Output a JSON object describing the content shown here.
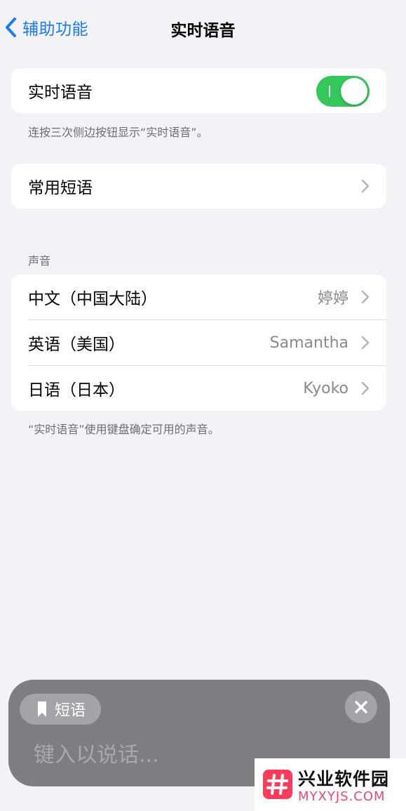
{
  "nav": {
    "back_label": "辅助功能",
    "title": "实时语音"
  },
  "main_toggle": {
    "label": "实时语音",
    "on": true,
    "footnote": "连按三次侧边按钮显示“实时语音”。"
  },
  "phrases": {
    "label": "常用短语"
  },
  "voices": {
    "header": "声音",
    "items": [
      {
        "label": "中文（中国大陆）",
        "value": "婷婷"
      },
      {
        "label": "英语（美国）",
        "value": "Samantha"
      },
      {
        "label": "日语（日本）",
        "value": "Kyoko"
      }
    ],
    "footnote": "“实时语音”使用键盘确定可用的声音。"
  },
  "live_speech_panel": {
    "chip_label": "短语",
    "input_placeholder": "键入以说话..."
  },
  "watermark": {
    "title": "兴业软件园",
    "subtitle": "MYXYJS.COM"
  },
  "colors": {
    "accent": "#1a7cf5",
    "toggle_on": "#34c759",
    "background": "#f2f2f7",
    "panel": "#7d7d82",
    "watermark_brand": "#ff3b5c"
  }
}
